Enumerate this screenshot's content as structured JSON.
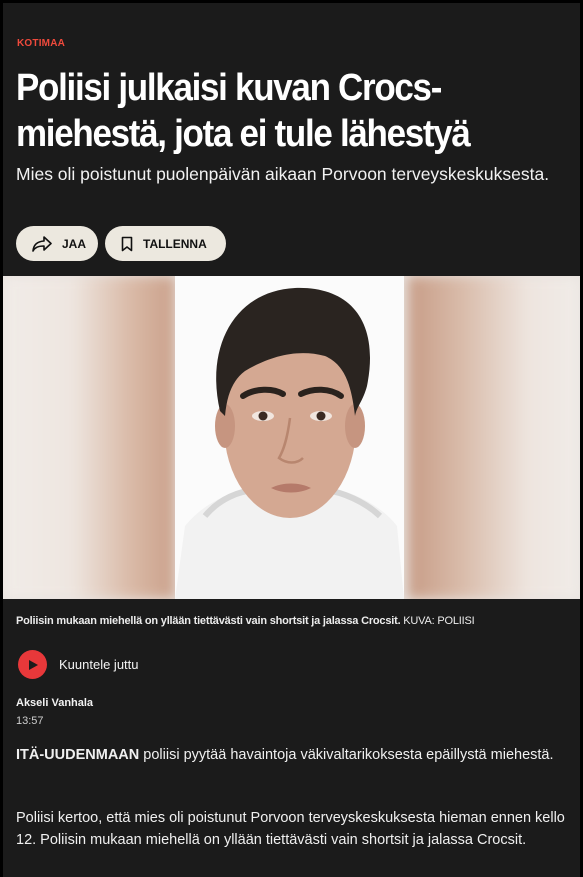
{
  "article": {
    "section": "KOTIMAA",
    "headline_line1": "Poliisi julkaisi kuvan Crocs-",
    "headline_line2": "miehestä, jota ei tule lähestyä",
    "lead": "Mies oli poistunut puolenpäivän aikaan Porvoon terveyskeskuksesta.",
    "actions": {
      "share_label": "JAA",
      "save_label": "TALLENNA"
    },
    "image": {
      "caption": "Poliisin mukaan miehellä on yllään tiettävästi vain shortsit ja jalassa Crocsit.",
      "credit": "KUVA: POLIISI"
    },
    "audio": {
      "label": "Kuuntele juttu"
    },
    "author": "Akseli Vanhala",
    "time": "13:57",
    "body": {
      "p1_lead": "ITÄ-UUDENMAAN",
      "p1_rest": " poliisi pyytää havaintoja väkivaltarikoksesta epäillystä miehestä.",
      "p2": "Poliisi kertoo, että mies oli poistunut Porvoon terveyskeskuksesta hieman ennen kello 12. Poliisin mukaan miehellä on yllään tiettävästi vain shortsit ja jalassa Crocsit."
    }
  },
  "colors": {
    "background": "#1b1b1b",
    "accent": "#f04a3c",
    "button_bg": "#ece8df",
    "play_red": "#e8383a"
  },
  "icons": {
    "share": "share-arrow-icon",
    "save": "bookmark-icon",
    "play": "play-icon"
  }
}
